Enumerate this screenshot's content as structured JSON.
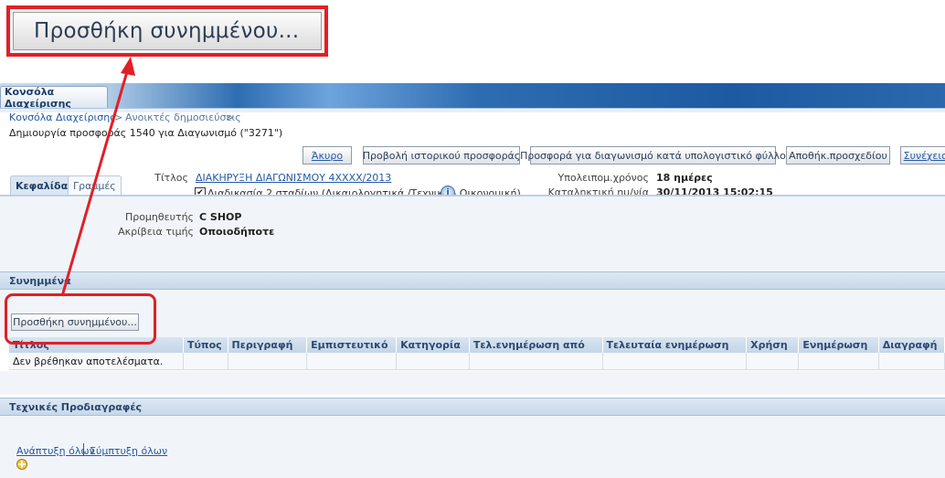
{
  "callout": {
    "button_label": "Προσθήκη συνημμένου..."
  },
  "titlebar": {
    "tab_label": "Κονσόλα Διαχείρισης"
  },
  "breadcrumb": {
    "item1": "Κονσόλα Διαχείρισης",
    "sep": ">",
    "item2": "Ανοικτές δημοσιεύσεις",
    "sep2": ">"
  },
  "page_title": "Δημιουργία προσφοράς 1540 για Διαγωνισμό (\"3271\")",
  "toolbar": {
    "cancel": "Άκυρο",
    "history": "Προβολή ιστορικού προσφοράς",
    "spreadsheet": "Προσφορά για διαγωνισμό κατά υπολογιστικό φύλλο",
    "save_draft": "Αποθήκ.προσχεδίου",
    "continue": "Συνέχεια"
  },
  "info": {
    "title_label": "Τίτλος",
    "title_value": "ΔΙΑΚΗΡΥΞΗ ΔΙΑΓΩΝΙΣΜΟΥ 4XXXX/2013",
    "two_stage": "Διαδικασία 2 σταδίων (Δικαιολογητικά /Τεχνική - Οικονομική)",
    "remaining_label": "Υπολειπομ.χρόνος",
    "remaining_value": "18 ημέρες",
    "deadline_label": "Καταληκτική ημ/νία υποβολής",
    "deadline_value": "30/11/2013 15:02:15"
  },
  "tabs": {
    "header": "Κεφαλίδα",
    "lines": "Γραμμές"
  },
  "header_panel": {
    "supplier_label": "Προμηθευτής",
    "supplier_value": "C SHOP",
    "precision_label": "Ακρίβεια τιμής",
    "precision_value": "Οποιοδήποτε"
  },
  "attachments": {
    "section_title": "Συνημμένα",
    "add_button": "Προσθήκη συνημμένου...",
    "columns": [
      "Τίτλος",
      "Τύπος",
      "Περιγραφή",
      "Εμπιστευτικό",
      "Κατηγορία",
      "Τελ.ενημέρωση από",
      "Τελευταία ενημέρωση",
      "Χρήση",
      "Ενημέρωση",
      "Διαγραφή"
    ],
    "empty_text": "Δεν βρέθηκαν αποτελέσματα."
  },
  "tech_specs": {
    "section_title": "Τεχνικές Προδιαγραφές",
    "expand_all": "Ανάπτυξη όλων",
    "collapse_all": "Σύμπτυξη όλων"
  },
  "colors": {
    "annotation": "#e21f26",
    "accent": "#2e6db2"
  }
}
